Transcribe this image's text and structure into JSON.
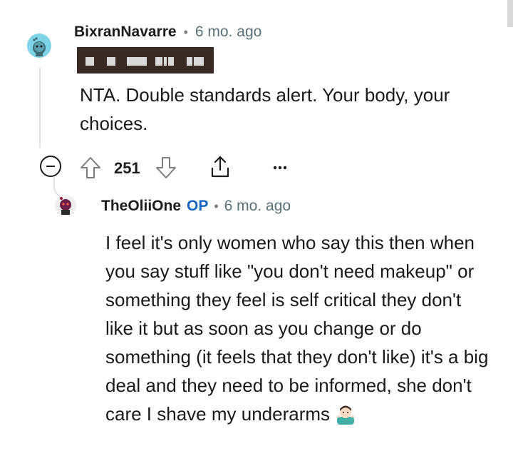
{
  "comment": {
    "author": "BixranNavarre",
    "separator": "•",
    "time": "6 mo. ago",
    "body": "NTA. Double standards alert. Your body, your choices.",
    "vote_count": "251",
    "icons": [
      "collapse-icon",
      "upvote-icon",
      "downvote-icon",
      "share-icon",
      "more-icon"
    ]
  },
  "reply": {
    "author": "TheOliiOne",
    "badge": "OP",
    "separator": "•",
    "time": "6 mo. ago",
    "body": "I feel it's only women who say this then when you say stuff like \"you don't need makeup\" or something they feel is self critical they don't like it but as soon as you change or do something (it feels that they don't like) it's a big deal and they need to be informed, she don't care I shave my underarms",
    "trailing_emoji": "man-shrugging-emoji"
  },
  "colors": {
    "avatar1": "#7fd3e6",
    "op_badge": "#1565c0",
    "meta_text": "#576f76",
    "redaction": "#3a2a25"
  }
}
